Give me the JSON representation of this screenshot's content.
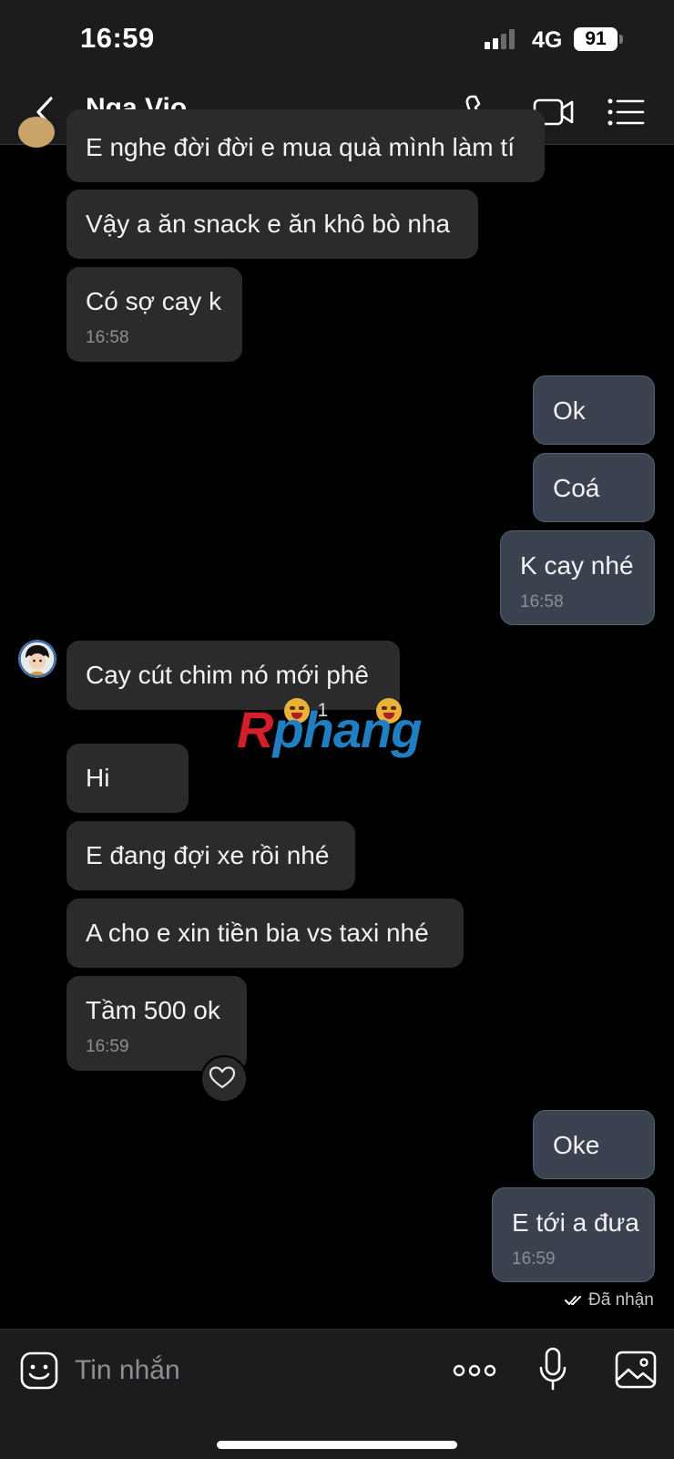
{
  "status_bar": {
    "time": "16:59",
    "network": "4G",
    "battery": "91"
  },
  "header": {
    "contact_name": "Nga Vio"
  },
  "messages": [
    {
      "text": "E nghe đời đời e mua quà mình làm tí",
      "time": ""
    },
    {
      "text": "Vậy a ăn snack e ăn khô bò nha",
      "time": ""
    },
    {
      "text": "Có sợ cay k",
      "time": "16:58"
    },
    {
      "text": "Ok",
      "time": ""
    },
    {
      "text": "Coá",
      "time": ""
    },
    {
      "text": "K cay nhé",
      "time": "16:58"
    },
    {
      "text": "Cay cút chim nó mới phê",
      "time": ""
    },
    {
      "text": "Hi",
      "time": ""
    },
    {
      "text": "E đang đợi xe rồi nhé",
      "time": ""
    },
    {
      "text": "A cho e xin tiền bia vs taxi nhé",
      "time": ""
    },
    {
      "text": "Tầm 500 ok",
      "time": "16:59"
    },
    {
      "text": "Oke",
      "time": ""
    },
    {
      "text": "E tới a đưa",
      "time": "16:59"
    }
  ],
  "reaction": {
    "count": "1"
  },
  "watermark": {
    "part1": "R",
    "part2": "phang"
  },
  "delivery_status": "Đã nhận",
  "composer": {
    "placeholder": "Tin nhắn"
  },
  "colors": {
    "incoming_bubble": "#2b2b2d",
    "outgoing_bubble": "#3a4250",
    "background": "#000000"
  },
  "icons": [
    "back-icon",
    "call-icon",
    "video-call-icon",
    "menu-list-icon",
    "emoji-icon",
    "more-icon",
    "microphone-icon",
    "image-icon",
    "heart-icon",
    "double-check-icon"
  ]
}
